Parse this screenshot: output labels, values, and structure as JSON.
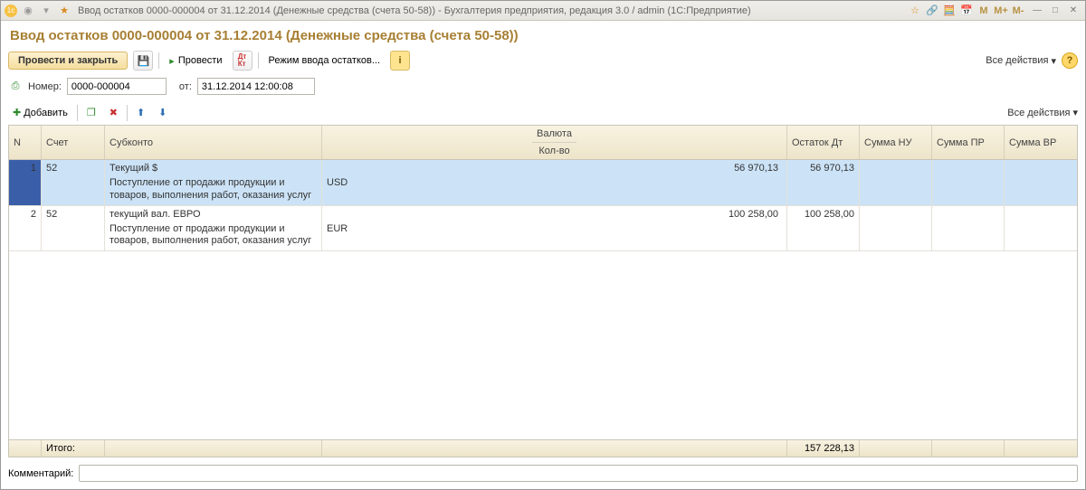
{
  "window_title": "Ввод остатков 0000-000004 от 31.12.2014 (Денежные средства (счета 50-58)) - Бухгалтерия предприятия, редакция 3.0 / admin  (1С:Предприятие)",
  "page_title": "Ввод остатков 0000-000004 от 31.12.2014 (Денежные средства (счета 50-58))",
  "toolbar": {
    "post_close": "Провести и закрыть",
    "post": "Провести",
    "mode": "Режим ввода остатков...",
    "all_actions": "Все действия"
  },
  "form": {
    "number_label": "Номер:",
    "number_value": "0000-000004",
    "from_label": "от:",
    "date_value": "31.12.2014 12:00:08"
  },
  "table_toolbar": {
    "add": "Добавить",
    "all_actions": "Все действия"
  },
  "headers": {
    "n": "N",
    "account": "Счет",
    "subkonto": "Субконто",
    "currency": "Валюта",
    "qty": "Кол-во",
    "balance_dt": "Остаток Дт",
    "sum_nu": "Сумма НУ",
    "sum_pr": "Сумма ПР",
    "sum_vr": "Сумма ВР"
  },
  "rows": [
    {
      "n": "1",
      "account": "52",
      "subkonto1": "Текущий $",
      "subkonto2": "Поступление от продажи продукции и товаров, выполнения работ, оказания услуг",
      "currency": "USD",
      "amount": "56 970,13",
      "balance_dt": "56 970,13",
      "selected": true
    },
    {
      "n": "2",
      "account": "52",
      "subkonto1": "текущий вал. ЕВРО",
      "subkonto2": "Поступление от продажи продукции и товаров, выполнения работ, оказания услуг",
      "currency": "EUR",
      "amount": "100 258,00",
      "balance_dt": "100 258,00",
      "selected": false
    }
  ],
  "footer": {
    "total_label": "Итого:",
    "total_balance": "157 228,13"
  },
  "comment": {
    "label": "Комментарий:",
    "value": ""
  }
}
